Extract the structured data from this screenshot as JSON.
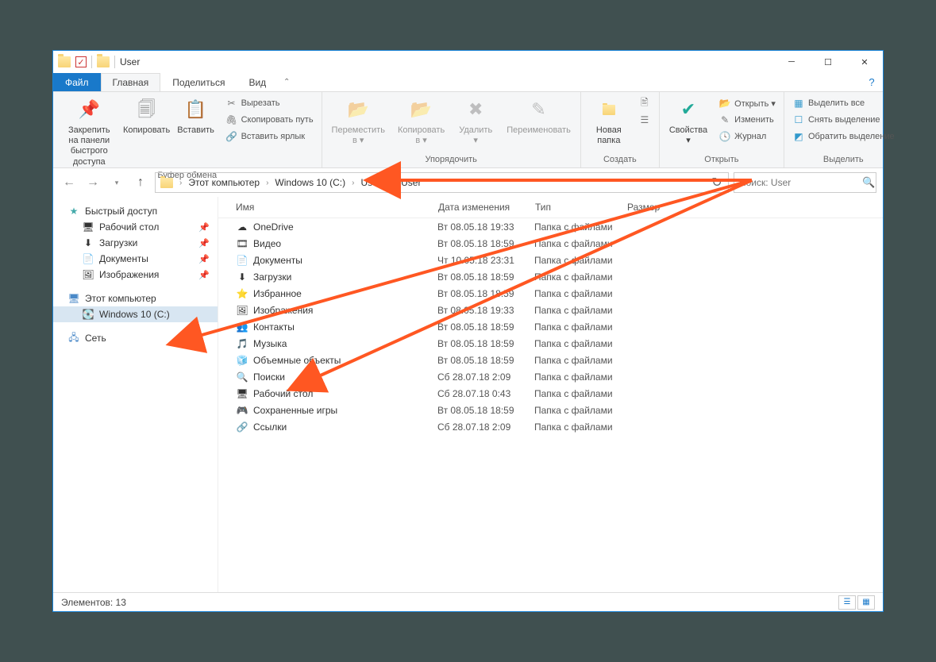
{
  "title": "User",
  "tabs": {
    "file": "Файл",
    "home": "Главная",
    "share": "Поделиться",
    "view": "Вид"
  },
  "ribbon": {
    "clipboard": {
      "label": "Буфер обмена",
      "pin": "Закрепить на панели\nбыстрого доступа",
      "copy": "Копировать",
      "paste": "Вставить",
      "cut": "Вырезать",
      "copy_path": "Скопировать путь",
      "paste_shortcut": "Вставить ярлык"
    },
    "organize": {
      "label": "Упорядочить",
      "move_to": "Переместить\nв ▾",
      "copy_to": "Копировать\nв ▾",
      "delete": "Удалить\n▾",
      "rename": "Переименовать"
    },
    "new": {
      "label": "Создать",
      "new_folder": "Новая\nпапка"
    },
    "open": {
      "label": "Открыть",
      "properties": "Свойства\n▾",
      "open": "Открыть ▾",
      "edit": "Изменить",
      "history": "Журнал"
    },
    "select": {
      "label": "Выделить",
      "select_all": "Выделить все",
      "select_none": "Снять выделение",
      "invert": "Обратить выделение"
    }
  },
  "breadcrumb": [
    "Этот компьютер",
    "Windows 10 (C:)",
    "Users",
    "User"
  ],
  "search_placeholder": "Поиск: User",
  "sidebar": {
    "quick_access": "Быстрый доступ",
    "quick_items": [
      {
        "icon": "🖥",
        "name": "Рабочий стол",
        "pinned": true
      },
      {
        "icon": "⬇",
        "name": "Загрузки",
        "pinned": true
      },
      {
        "icon": "📄",
        "name": "Документы",
        "pinned": true
      },
      {
        "icon": "🖼",
        "name": "Изображения",
        "pinned": true
      }
    ],
    "this_pc": "Этот компьютер",
    "drives": [
      {
        "icon": "💽",
        "name": "Windows 10 (C:)"
      }
    ],
    "network": "Сеть"
  },
  "columns": {
    "name": "Имя",
    "date": "Дата изменения",
    "type": "Тип",
    "size": "Размер"
  },
  "files": [
    {
      "icon": "☁",
      "name": "OneDrive",
      "date": "Вт 08.05.18 19:33",
      "type": "Папка с файлами"
    },
    {
      "icon": "🎞",
      "name": "Видео",
      "date": "Вт 08.05.18 18:59",
      "type": "Папка с файлами"
    },
    {
      "icon": "📄",
      "name": "Документы",
      "date": "Чт 10.05.18 23:31",
      "type": "Папка с файлами"
    },
    {
      "icon": "⬇",
      "name": "Загрузки",
      "date": "Вт 08.05.18 18:59",
      "type": "Папка с файлами"
    },
    {
      "icon": "⭐",
      "name": "Избранное",
      "date": "Вт 08.05.18 18:59",
      "type": "Папка с файлами"
    },
    {
      "icon": "🖼",
      "name": "Изображения",
      "date": "Вт 08.05.18 19:33",
      "type": "Папка с файлами"
    },
    {
      "icon": "👥",
      "name": "Контакты",
      "date": "Вт 08.05.18 18:59",
      "type": "Папка с файлами"
    },
    {
      "icon": "🎵",
      "name": "Музыка",
      "date": "Вт 08.05.18 18:59",
      "type": "Папка с файлами"
    },
    {
      "icon": "🧊",
      "name": "Объемные объекты",
      "date": "Вт 08.05.18 18:59",
      "type": "Папка с файлами"
    },
    {
      "icon": "🔍",
      "name": "Поиски",
      "date": "Сб 28.07.18 2:09",
      "type": "Папка с файлами"
    },
    {
      "icon": "🖥",
      "name": "Рабочий стол",
      "date": "Сб 28.07.18 0:43",
      "type": "Папка с файлами"
    },
    {
      "icon": "🎮",
      "name": "Сохраненные игры",
      "date": "Вт 08.05.18 18:59",
      "type": "Папка с файлами"
    },
    {
      "icon": "🔗",
      "name": "Ссылки",
      "date": "Сб 28.07.18 2:09",
      "type": "Папка с файлами"
    }
  ],
  "status": "Элементов: 13"
}
